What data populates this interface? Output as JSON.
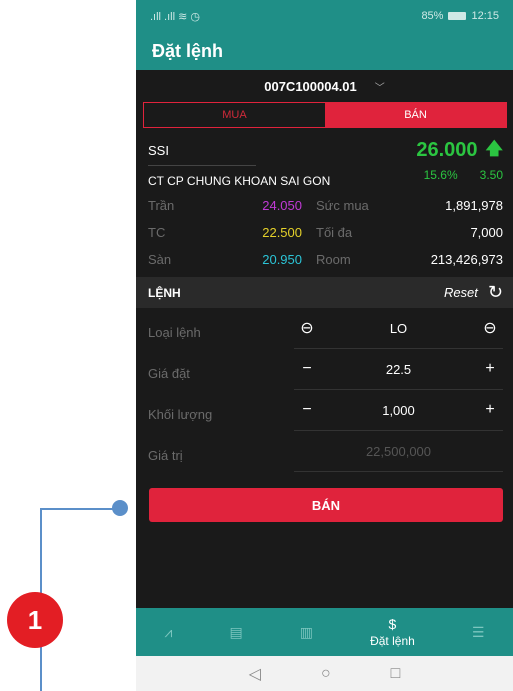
{
  "callout": {
    "badge": "1"
  },
  "status_bar": {
    "signal": ".ıll .ıll ≋ ◷",
    "battery": "85%",
    "time": "12:15"
  },
  "header": {
    "title": "Đặt lệnh"
  },
  "account": {
    "number": "007C100004.01"
  },
  "tabs": {
    "buy": "MUA",
    "sell": "BÁN"
  },
  "stock": {
    "symbol": "SSI",
    "price": "26.000",
    "company": "CT CP CHUNG KHOAN SAI GON",
    "change_pct": "15.6%",
    "change_val": "3.50"
  },
  "info": [
    {
      "label": "Trần",
      "value": "24.050",
      "label2": "Sức mua",
      "value2": "1,891,978"
    },
    {
      "label": "TC",
      "value": "22.500",
      "label2": "Tối đa",
      "value2": "7,000"
    },
    {
      "label": "Sàn",
      "value": "20.950",
      "label2": "Room",
      "value2": "213,426,973"
    }
  ],
  "order": {
    "section_title": "LỆNH",
    "reset_label": "Reset",
    "type_label": "Loại lệnh",
    "type_value": "LO",
    "price_label": "Giá đặt",
    "price_value": "22.5",
    "qty_label": "Khối lượng",
    "qty_value": "1,000",
    "value_label": "Giá trị",
    "value_value": "22,500,000"
  },
  "submit_label": "BÁN",
  "bottom_nav": {
    "active_label": "Đặt lệnh"
  },
  "colors": {
    "teal": "#1f8f87",
    "red": "#e0233c",
    "green": "#2bc541"
  }
}
